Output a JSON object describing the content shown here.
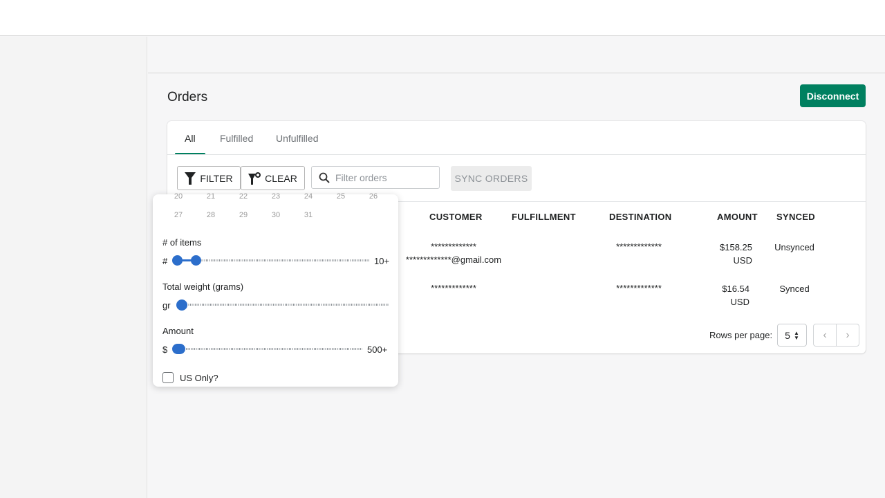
{
  "header": {
    "title": "Orders",
    "disconnect_label": "Disconnect"
  },
  "tabs": [
    {
      "label": "All",
      "active": true
    },
    {
      "label": "Fulfilled"
    },
    {
      "label": "Unfulfilled"
    }
  ],
  "toolbar": {
    "filter_label": "FILTER",
    "clear_label": "CLEAR",
    "search_placeholder": "Filter orders",
    "sync_label": "SYNC ORDERS"
  },
  "table": {
    "columns": [
      "CUSTOMER",
      "FULFILLMENT",
      "DESTINATION",
      "AMOUNT",
      "SYNCED"
    ],
    "rows": [
      {
        "customer_name": "*************",
        "customer_email": "*************@gmail.com",
        "fulfillment": "",
        "destination": "*************",
        "amount": "$158.25",
        "currency": "USD",
        "synced": "Unsynced"
      },
      {
        "customer_name": "*************",
        "customer_email": "",
        "fulfillment": "",
        "destination": "*************",
        "amount": "$16.54",
        "currency": "USD",
        "synced": "Synced"
      }
    ]
  },
  "pagination": {
    "rows_per_page_label": "Rows per page:",
    "rows_per_page": "5"
  },
  "filter_popup": {
    "calendar_rows": [
      [
        "20",
        "21",
        "22",
        "23",
        "24",
        "25",
        "26"
      ],
      [
        "27",
        "28",
        "29",
        "30",
        "31"
      ]
    ],
    "items": {
      "label": "# of items",
      "prefix": "#",
      "max_label": "10+",
      "range": [
        0,
        1
      ],
      "max": 10
    },
    "weight": {
      "label": "Total weight (grams)",
      "prefix": "gr",
      "value": 0
    },
    "amount": {
      "label": "Amount",
      "prefix": "$",
      "max_label": "500+",
      "range": [
        0,
        0
      ]
    },
    "us_only": {
      "label": "US Only?",
      "checked": false
    }
  },
  "colors": {
    "accent": "#008060",
    "slider": "#2c6ecb"
  }
}
